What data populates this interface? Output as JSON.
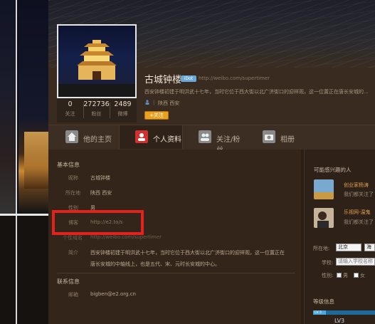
{
  "profile": {
    "name": "古城钟楼",
    "verified_label": "iDot",
    "home_url": "http://weibo.com/supertimer",
    "bio": "西安钟楼初建于明洪武十七年，当时它位于西大街以北广济街口的迎祥观，这一位置正在唐长安城的...",
    "location": "陕西 西安",
    "location_sep": "|",
    "follow_label": "+关注"
  },
  "stats": [
    {
      "value": "0",
      "label": "关注"
    },
    {
      "value": "272736",
      "label": "粉丝"
    },
    {
      "value": "2489",
      "label": "微博"
    }
  ],
  "nav": {
    "tabs": [
      {
        "label": "他的主页",
        "icon": "home-icon"
      },
      {
        "label": "个人资料",
        "icon": "profile-icon"
      },
      {
        "label": "关注/粉丝",
        "icon": "people-icon"
      },
      {
        "label": "相册",
        "icon": "camera-icon"
      }
    ]
  },
  "basic_info": {
    "title": "基本信息",
    "rows": [
      {
        "label": "昵称",
        "value": "古城钟楼"
      },
      {
        "label": "所在地",
        "value": "陕西 西安"
      },
      {
        "label": "性别",
        "value": "男"
      },
      {
        "label": "博客",
        "value": "http://e2.to/s"
      },
      {
        "label": "个性域名",
        "value": "http://weibo.com/supertimer"
      },
      {
        "label": "简介",
        "value": "西安钟楼初建于明洪武十七年，当时它位于西大街以北广济街口的迎祥观，这一位置正在",
        "value2": "唐长安城的中轴线上，也是五代、宋、元时长安城的中心。"
      }
    ]
  },
  "contact_info": {
    "title": "联系信息",
    "rows": [
      {
        "label": "邮箱",
        "value": "bigben@e2.org.cn"
      }
    ]
  },
  "sidebar": {
    "suggest_title": "可能感兴趣的人",
    "suggestions": [
      {
        "name": "创业家杨涛",
        "sub": "我们都关注了"
      },
      {
        "name": "乐视网-温鬼",
        "sub": "我们都关注了"
      }
    ],
    "location_label": "所在地:",
    "location_select": "北京",
    "location_select2": "海",
    "school_label": "学校:",
    "school_placeholder": "请输入学校名称",
    "gender_label": "性别:",
    "gender_male": "男",
    "gender_female": "女",
    "level_title": "等级信息",
    "level_bar_label": "LV.3",
    "level_text": "LV3"
  },
  "colors": {
    "accent": "#e8a020",
    "highlight": "#e3221b",
    "link": "#e2a050"
  }
}
